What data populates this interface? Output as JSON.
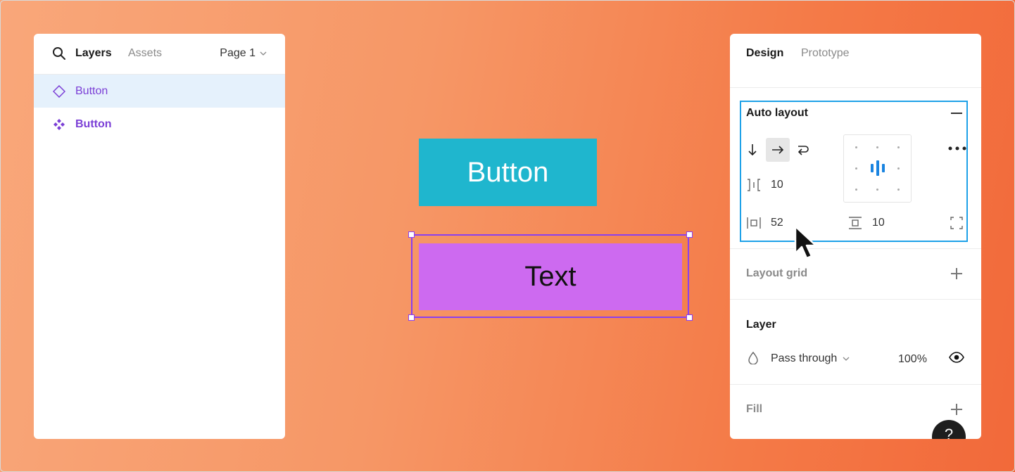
{
  "layers_panel": {
    "tabs": [
      "Layers",
      "Assets"
    ],
    "page": "Page 1",
    "items": [
      {
        "label": "Button",
        "icon": "component-instance-icon",
        "selected": true
      },
      {
        "label": "Button",
        "icon": "main-component-icon",
        "selected": false
      }
    ]
  },
  "canvas": {
    "button_label": "Button",
    "text_label": "Text"
  },
  "design_panel": {
    "tabs": [
      "Design",
      "Prototype"
    ],
    "auto_layout": {
      "title": "Auto layout",
      "gap": "10",
      "horizontal_padding": "52",
      "vertical_padding": "10"
    },
    "layout_grid": {
      "title": "Layout grid"
    },
    "layer": {
      "title": "Layer",
      "blend_mode": "Pass through",
      "opacity": "100%"
    },
    "fill": {
      "title": "Fill"
    },
    "help": "?"
  },
  "colors": {
    "accent_blue": "#1ea1e8",
    "selection_purple": "#8a3ff0",
    "cyan_button": "#1fb6ce",
    "purple_button": "#cd6af0",
    "layer_text": "#7b3fd6"
  }
}
